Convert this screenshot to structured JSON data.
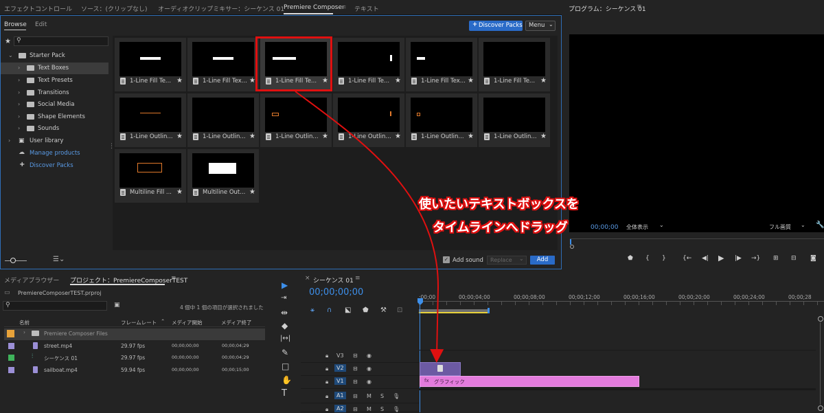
{
  "top_tabs": [
    "エフェクトコントロール",
    "ソース：(クリップなし)",
    "オーディオクリップミキサー：シーケンス 01",
    "Premiere Composer",
    "テキスト"
  ],
  "program_tab": "プログラム：シーケンス 01",
  "composer": {
    "sub_tabs": [
      "Browse",
      "Edit"
    ],
    "discover_button": "Discover Packs",
    "menu_button": "Menu",
    "tree": [
      {
        "label": "Starter Pack"
      },
      {
        "label": "Text Boxes"
      },
      {
        "label": "Text Presets"
      },
      {
        "label": "Transitions"
      },
      {
        "label": "Social Media"
      },
      {
        "label": "Shape Elements"
      },
      {
        "label": "Sounds"
      },
      {
        "label": "User library"
      },
      {
        "label": "Manage products"
      },
      {
        "label": "Discover Packs"
      }
    ],
    "tiles": [
      {
        "name": "1-Line Fill Te..."
      },
      {
        "name": "1-Line Fill Tex..."
      },
      {
        "name": "1-Line Fill Te..."
      },
      {
        "name": "1-Line Fill Te..."
      },
      {
        "name": "1-Line Fill Tex..."
      },
      {
        "name": "1-Line Fill Te..."
      },
      {
        "name": "1-Line Outlin..."
      },
      {
        "name": "1-Line Outlin..."
      },
      {
        "name": "1-Line Outlin..."
      },
      {
        "name": "1-Line Outlin..."
      },
      {
        "name": "1-Line Outlin..."
      },
      {
        "name": "1-Line Outlin..."
      },
      {
        "name": "Multiline Fill ..."
      },
      {
        "name": "Multiline Out..."
      }
    ],
    "add_sound": "Add sound",
    "replace": "Replace",
    "add": "Add"
  },
  "program": {
    "timecode": "00;00;00",
    "zoom": "全体表示",
    "quality": "フル画質"
  },
  "callout": {
    "line1": "使いたいテキストボックスを",
    "line2": "タイムラインへドラッグ"
  },
  "project": {
    "tabs": [
      "メディアブラウザー",
      "プロジェクト：PremiereComposerTEST"
    ],
    "file": "PremiereComposerTEST.prproj",
    "status": "4 個中 1 個の項目が選択されました",
    "columns": [
      "名前",
      "フレームレート",
      "メディア開始",
      "メディア終了"
    ],
    "rows": [
      {
        "name": "Premiere Composer Files",
        "rate": "",
        "start": "",
        "end": "",
        "color": "#e8a33a"
      },
      {
        "name": "street.mp4",
        "rate": "29.97 fps",
        "start": "00;00;00;00",
        "end": "00;00;04;29",
        "color": "#9b8fd6"
      },
      {
        "name": "シーケンス 01",
        "rate": "29.97 fps",
        "start": "00;00;00;00",
        "end": "00;00;04;29",
        "color": "#3fb35b"
      },
      {
        "name": "sailboat.mp4",
        "rate": "59.94 fps",
        "start": "00;00;00;00",
        "end": "00;00;15;00",
        "color": "#9b8fd6"
      }
    ]
  },
  "timeline": {
    "tab": "シーケンス 01",
    "timecode": "00;00;00;00",
    "ruler": [
      ";00;00",
      "00;00;04;00",
      "00;00;08;00",
      "00;00;12;00",
      "00;00;16;00",
      "00;00;20;00",
      "00;00;24;00",
      "00;00;28"
    ],
    "tracks": [
      "V3",
      "V2",
      "V1",
      "A1",
      "A2"
    ],
    "clip_label": "グラフィック",
    "track_letters": {
      "m": "M",
      "s": "S"
    }
  }
}
